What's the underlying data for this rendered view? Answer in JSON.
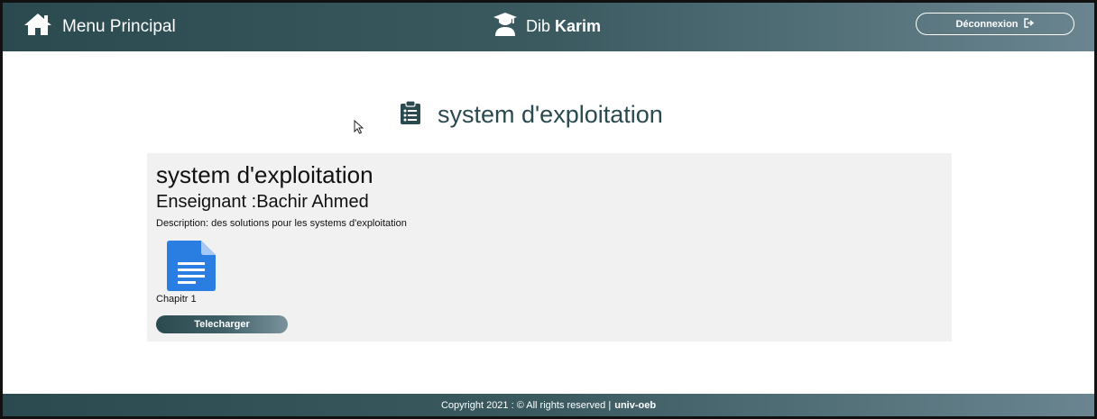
{
  "header": {
    "home_label": "Menu Principal",
    "user_first": "Dib",
    "user_last": "Karim",
    "logout_label": "Déconnexion"
  },
  "page": {
    "heading": "system d'exploitation"
  },
  "course": {
    "title": "system d'exploitation",
    "teacher": "Enseignant :Bachir Ahmed",
    "description": "Description: des solutions pour les systems d'exploitation",
    "file_name": "Chapitr 1",
    "download_label": "Telecharger"
  },
  "footer": {
    "text": "Copyright 2021 : © All rights reserved |",
    "brand": "univ-oeb"
  },
  "icons": {
    "home": "home-icon",
    "user": "graduate-user-icon",
    "logout": "sign-out-icon",
    "heading": "clipboard-list-icon",
    "document": "document-icon",
    "cursor": "mouse-cursor-icon"
  },
  "colors": {
    "header_dark": "#2b4a4f",
    "header_light": "#6a8590",
    "heading_text": "#2a4a50",
    "card_bg": "#f1f1f1",
    "doc_blue": "#2a7de1"
  }
}
